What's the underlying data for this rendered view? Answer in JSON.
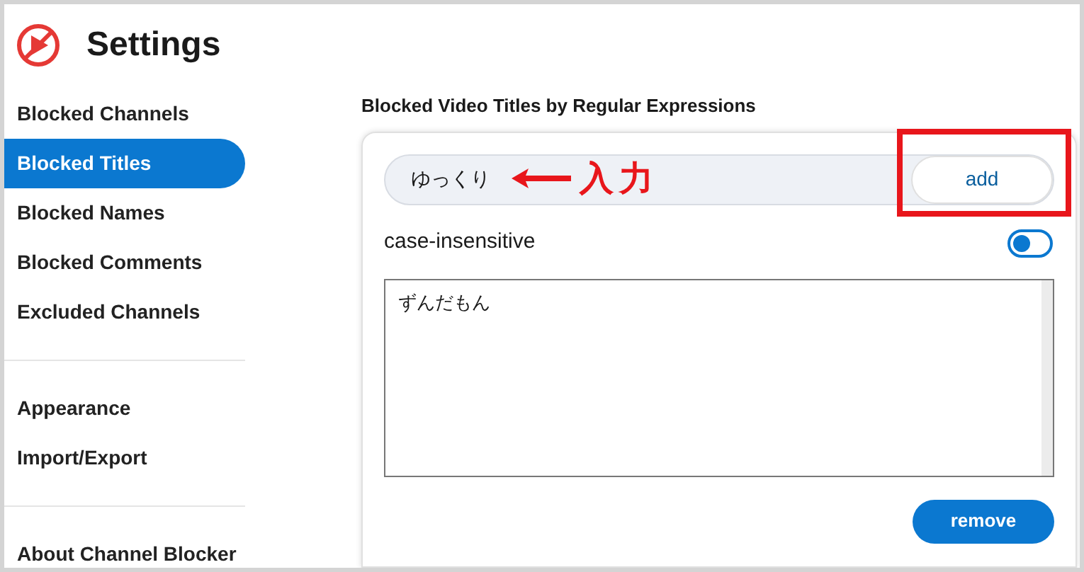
{
  "header": {
    "title": "Settings"
  },
  "sidebar": {
    "groups": [
      {
        "items": [
          {
            "label": "Blocked Channels",
            "selected": false
          },
          {
            "label": "Blocked Titles",
            "selected": true
          },
          {
            "label": "Blocked Names",
            "selected": false
          },
          {
            "label": "Blocked Comments",
            "selected": false
          },
          {
            "label": "Excluded Channels",
            "selected": false
          }
        ]
      },
      {
        "items": [
          {
            "label": "Appearance",
            "selected": false
          },
          {
            "label": "Import/Export",
            "selected": false
          }
        ]
      },
      {
        "items": [
          {
            "label": "About Channel Blocker",
            "selected": false
          }
        ]
      }
    ]
  },
  "section": {
    "title": "Blocked Video Titles by Regular Expressions",
    "input": {
      "value": "ゆっくり"
    },
    "add_button": "add",
    "toggle": {
      "label": "case-insensitive",
      "on": false
    },
    "list": [
      {
        "text": "ずんだもん",
        "selected": false
      }
    ],
    "remove_button": "remove"
  },
  "annotation": {
    "label": "入力"
  }
}
